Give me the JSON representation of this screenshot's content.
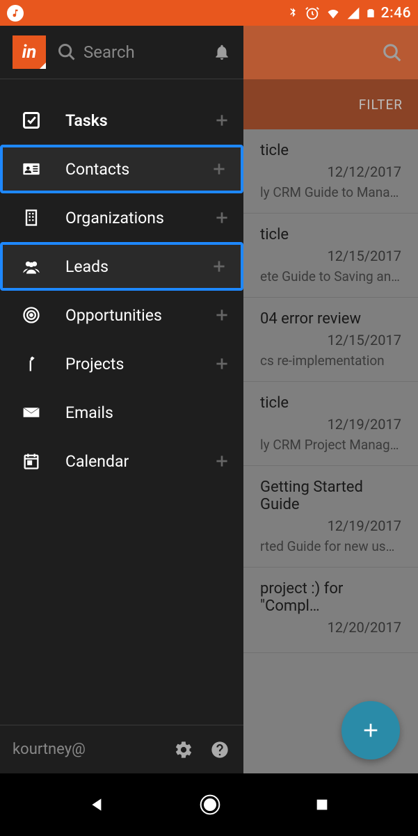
{
  "status": {
    "time": "2:46"
  },
  "main": {
    "filter_label": "FILTER",
    "items": [
      {
        "title_suffix": "ticle",
        "date": "12/12/2017",
        "desc_suffix": "ly CRM Guide to Mana…"
      },
      {
        "title_suffix": "ticle",
        "date": "12/15/2017",
        "desc_suffix": "ete Guide to Saving an…"
      },
      {
        "title_suffix": "04 error review",
        "date": "12/15/2017",
        "desc_suffix": "cs re-implementation"
      },
      {
        "title_suffix": "ticle",
        "date": "12/19/2017",
        "desc_suffix": "ly CRM Project Manag…"
      },
      {
        "title_suffix": "Getting Started Guide",
        "date": "12/19/2017",
        "desc_suffix": "rted Guide for new users"
      },
      {
        "title_suffix": "project :) for \"Compl…",
        "date": "12/20/2017",
        "desc_suffix": ""
      }
    ]
  },
  "drawer": {
    "search_placeholder": "Search",
    "nav": [
      {
        "label": "Tasks",
        "has_add": true,
        "highlighted": false,
        "bold": true,
        "icon": "checkbox"
      },
      {
        "label": "Contacts",
        "has_add": true,
        "highlighted": true,
        "bold": false,
        "icon": "contact-card"
      },
      {
        "label": "Organizations",
        "has_add": true,
        "highlighted": false,
        "bold": false,
        "icon": "building"
      },
      {
        "label": "Leads",
        "has_add": true,
        "highlighted": true,
        "bold": false,
        "icon": "people"
      },
      {
        "label": "Opportunities",
        "has_add": true,
        "highlighted": false,
        "bold": false,
        "icon": "target"
      },
      {
        "label": "Projects",
        "has_add": true,
        "highlighted": false,
        "bold": false,
        "icon": "hammer"
      },
      {
        "label": "Emails",
        "has_add": false,
        "highlighted": false,
        "bold": false,
        "icon": "envelope"
      },
      {
        "label": "Calendar",
        "has_add": true,
        "highlighted": false,
        "bold": false,
        "icon": "calendar"
      }
    ],
    "footer": {
      "username": "kourtney@"
    }
  }
}
